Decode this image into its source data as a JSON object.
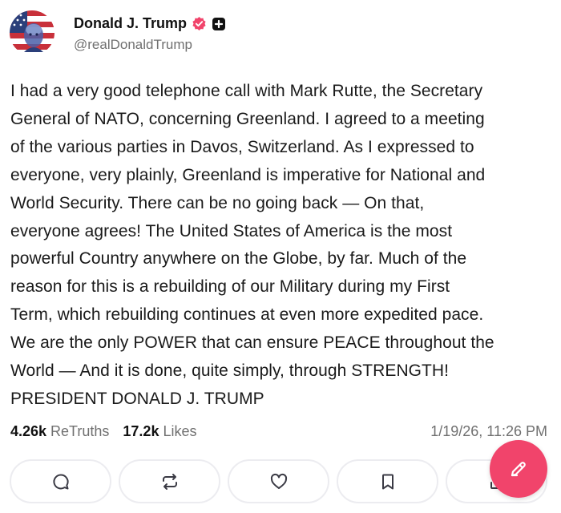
{
  "author": {
    "display_name": "Donald J. Trump",
    "handle": "@realDonaldTrump",
    "avatar_icon": "flag-portrait-avatar",
    "verified_icon": "verified-badge-icon",
    "plus_icon": "plus-badge-icon"
  },
  "post": {
    "lines": [
      "I had a very good telephone call with Mark Rutte, the Secretary",
      "General of NATO, concerning Greenland. I agreed to a meeting",
      "of the various parties in Davos, Switzerland. As I expressed to",
      "everyone, very plainly, Greenland is imperative for National and",
      "World Security. There can be no going back — On that,",
      "everyone agrees! The United States of America is the most",
      "powerful Country anywhere on the Globe, by far. Much of the",
      "reason for this is a rebuilding of our Military during my First",
      "Term, which rebuilding continues at even more expedited pace.",
      "We are the only POWER that can ensure PEACE throughout the",
      "World — And it is done, quite simply, through STRENGTH!",
      "PRESIDENT DONALD J. TRUMP"
    ]
  },
  "stats": {
    "retruths_count": "4.26k",
    "retruths_label": "ReTruths",
    "likes_count": "17.2k",
    "likes_label": "Likes",
    "timestamp": "1/19/26, 11:26 PM"
  },
  "actions": [
    {
      "icon": "reply-icon"
    },
    {
      "icon": "retruth-icon"
    },
    {
      "icon": "like-heart-icon"
    },
    {
      "icon": "bookmark-icon"
    },
    {
      "icon": "share-icon"
    }
  ],
  "fab": {
    "icon": "compose-pencil-icon"
  },
  "colors": {
    "accent": "#f1446b",
    "muted_text": "#707070",
    "button_border": "#ececf0"
  }
}
